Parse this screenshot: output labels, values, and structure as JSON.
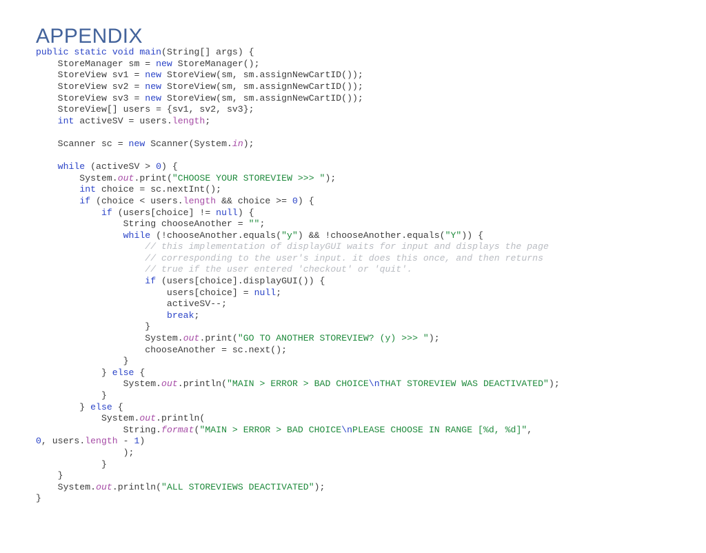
{
  "page": {
    "title": "APPENDIX",
    "background_color": "#ffffff",
    "title_color": "#43639b"
  },
  "code": {
    "language": "Java",
    "theme_colors": {
      "keyword": "#2b44c7",
      "string": "#1f8a3c",
      "escape": "#2b44c7",
      "number": "#2b44c7",
      "static_field": "#a64ca6",
      "member": "#a64ca6",
      "comment": "#b9bcc2",
      "plain": "#3c3c3c"
    },
    "plain_text": "public static void main(String[] args) {\n    StoreManager sm = new StoreManager();\n    StoreView sv1 = new StoreView(sm, sm.assignNewCartID());\n    StoreView sv2 = new StoreView(sm, sm.assignNewCartID());\n    StoreView sv3 = new StoreView(sm, sm.assignNewCartID());\n    StoreView[] users = {sv1, sv2, sv3};\n    int activeSV = users.length;\n\n    Scanner sc = new Scanner(System.in);\n\n    while (activeSV > 0) {\n        System.out.print(\"CHOOSE YOUR STOREVIEW >>> \");\n        int choice = sc.nextInt();\n        if (choice < users.length && choice >= 0) {\n            if (users[choice] != null) {\n                String chooseAnother = \"\";\n                while (!chooseAnother.equals(\"y\") && !chooseAnother.equals(\"Y\")) {\n                    // this implementation of displayGUI waits for input and displays the page\n                    // corresponding to the user's input. it does this once, and then returns\n                    // true if the user entered 'checkout' or 'quit'.\n                    if (users[choice].displayGUI()) {\n                        users[choice] = null;\n                        activeSV--;\n                        break;\n                    }\n                    System.out.print(\"GO TO ANOTHER STOREVIEW? (y) >>> \");\n                    chooseAnother = sc.next();\n                }\n            } else {\n                System.out.println(\"MAIN > ERROR > BAD CHOICE\\nTHAT STOREVIEW WAS DEACTIVATED\");\n            }\n        } else {\n            System.out.println(\n                String.format(\"MAIN > ERROR > BAD CHOICE\\nPLEASE CHOOSE IN RANGE [%d, %d]\",\n0, users.length - 1)\n            );\n        }\n    }\n    System.out.println(\"ALL STOREVIEWS DEACTIVATED\");\n}",
    "lines": [
      [
        {
          "t": "public",
          "c": "kw"
        },
        {
          "t": " ",
          "c": "pln"
        },
        {
          "t": "static",
          "c": "kw"
        },
        {
          "t": " ",
          "c": "pln"
        },
        {
          "t": "void",
          "c": "kw"
        },
        {
          "t": " ",
          "c": "pln"
        },
        {
          "t": "main",
          "c": "kw"
        },
        {
          "t": "(String[] args) {",
          "c": "pln"
        }
      ],
      [
        {
          "t": "    StoreManager sm = ",
          "c": "pln"
        },
        {
          "t": "new",
          "c": "kw"
        },
        {
          "t": " StoreManager();",
          "c": "pln"
        }
      ],
      [
        {
          "t": "    StoreView sv1 = ",
          "c": "pln"
        },
        {
          "t": "new",
          "c": "kw"
        },
        {
          "t": " StoreView(sm, sm.assignNewCartID());",
          "c": "pln"
        }
      ],
      [
        {
          "t": "    StoreView sv2 = ",
          "c": "pln"
        },
        {
          "t": "new",
          "c": "kw"
        },
        {
          "t": " StoreView(sm, sm.assignNewCartID());",
          "c": "pln"
        }
      ],
      [
        {
          "t": "    StoreView sv3 = ",
          "c": "pln"
        },
        {
          "t": "new",
          "c": "kw"
        },
        {
          "t": " StoreView(sm, sm.assignNewCartID());",
          "c": "pln"
        }
      ],
      [
        {
          "t": "    StoreView[] users = {sv1, sv2, sv3};",
          "c": "pln"
        }
      ],
      [
        {
          "t": "    ",
          "c": "pln"
        },
        {
          "t": "int",
          "c": "kw"
        },
        {
          "t": " activeSV = users.",
          "c": "pln"
        },
        {
          "t": "length",
          "c": "mem"
        },
        {
          "t": ";",
          "c": "pln"
        }
      ],
      [
        {
          "t": "",
          "c": "pln"
        }
      ],
      [
        {
          "t": "    Scanner sc = ",
          "c": "pln"
        },
        {
          "t": "new",
          "c": "kw"
        },
        {
          "t": " Scanner(System.",
          "c": "pln"
        },
        {
          "t": "in",
          "c": "fld"
        },
        {
          "t": ");",
          "c": "pln"
        }
      ],
      [
        {
          "t": "",
          "c": "pln"
        }
      ],
      [
        {
          "t": "    ",
          "c": "pln"
        },
        {
          "t": "while",
          "c": "kw"
        },
        {
          "t": " (activeSV > ",
          "c": "pln"
        },
        {
          "t": "0",
          "c": "num"
        },
        {
          "t": ") {",
          "c": "pln"
        }
      ],
      [
        {
          "t": "        System.",
          "c": "pln"
        },
        {
          "t": "out",
          "c": "fld"
        },
        {
          "t": ".print(",
          "c": "pln"
        },
        {
          "t": "\"CHOOSE YOUR STOREVIEW >>> \"",
          "c": "str"
        },
        {
          "t": ");",
          "c": "pln"
        }
      ],
      [
        {
          "t": "        ",
          "c": "pln"
        },
        {
          "t": "int",
          "c": "kw"
        },
        {
          "t": " choice = sc.nextInt();",
          "c": "pln"
        }
      ],
      [
        {
          "t": "        ",
          "c": "pln"
        },
        {
          "t": "if",
          "c": "kw"
        },
        {
          "t": " (choice < users.",
          "c": "pln"
        },
        {
          "t": "length",
          "c": "mem"
        },
        {
          "t": " && choice >= ",
          "c": "pln"
        },
        {
          "t": "0",
          "c": "num"
        },
        {
          "t": ") {",
          "c": "pln"
        }
      ],
      [
        {
          "t": "            ",
          "c": "pln"
        },
        {
          "t": "if",
          "c": "kw"
        },
        {
          "t": " (users[choice] != ",
          "c": "pln"
        },
        {
          "t": "null",
          "c": "kw"
        },
        {
          "t": ") {",
          "c": "pln"
        }
      ],
      [
        {
          "t": "                String chooseAnother = ",
          "c": "pln"
        },
        {
          "t": "\"\"",
          "c": "str"
        },
        {
          "t": ";",
          "c": "pln"
        }
      ],
      [
        {
          "t": "                ",
          "c": "pln"
        },
        {
          "t": "while",
          "c": "kw"
        },
        {
          "t": " (!chooseAnother.equals(",
          "c": "pln"
        },
        {
          "t": "\"y\"",
          "c": "str"
        },
        {
          "t": ") && !chooseAnother.equals(",
          "c": "pln"
        },
        {
          "t": "\"Y\"",
          "c": "str"
        },
        {
          "t": ")) {",
          "c": "pln"
        }
      ],
      [
        {
          "t": "                    // this implementation of displayGUI waits for input and displays the page",
          "c": "cmt"
        }
      ],
      [
        {
          "t": "                    // corresponding to the user's input. it does this once, and then returns",
          "c": "cmt"
        }
      ],
      [
        {
          "t": "                    // true if the user entered 'checkout' or 'quit'.",
          "c": "cmt"
        }
      ],
      [
        {
          "t": "                    ",
          "c": "pln"
        },
        {
          "t": "if",
          "c": "kw"
        },
        {
          "t": " (users[choice].displayGUI()) {",
          "c": "pln"
        }
      ],
      [
        {
          "t": "                        users[choice] = ",
          "c": "pln"
        },
        {
          "t": "null",
          "c": "kw"
        },
        {
          "t": ";",
          "c": "pln"
        }
      ],
      [
        {
          "t": "                        activeSV--;",
          "c": "pln"
        }
      ],
      [
        {
          "t": "                        ",
          "c": "pln"
        },
        {
          "t": "break",
          "c": "kw"
        },
        {
          "t": ";",
          "c": "pln"
        }
      ],
      [
        {
          "t": "                    }",
          "c": "pln"
        }
      ],
      [
        {
          "t": "                    System.",
          "c": "pln"
        },
        {
          "t": "out",
          "c": "fld"
        },
        {
          "t": ".print(",
          "c": "pln"
        },
        {
          "t": "\"GO TO ANOTHER STOREVIEW? (y) >>> \"",
          "c": "str"
        },
        {
          "t": ");",
          "c": "pln"
        }
      ],
      [
        {
          "t": "                    chooseAnother = sc.next();",
          "c": "pln"
        }
      ],
      [
        {
          "t": "                }",
          "c": "pln"
        }
      ],
      [
        {
          "t": "            } ",
          "c": "pln"
        },
        {
          "t": "else",
          "c": "kw"
        },
        {
          "t": " {",
          "c": "pln"
        }
      ],
      [
        {
          "t": "                System.",
          "c": "pln"
        },
        {
          "t": "out",
          "c": "fld"
        },
        {
          "t": ".println(",
          "c": "pln"
        },
        {
          "t": "\"MAIN > ERROR > BAD CHOICE",
          "c": "str"
        },
        {
          "t": "\\n",
          "c": "esc"
        },
        {
          "t": "THAT STOREVIEW WAS DEACTIVATED\"",
          "c": "str"
        },
        {
          "t": ");",
          "c": "pln"
        }
      ],
      [
        {
          "t": "            }",
          "c": "pln"
        }
      ],
      [
        {
          "t": "        } ",
          "c": "pln"
        },
        {
          "t": "else",
          "c": "kw"
        },
        {
          "t": " {",
          "c": "pln"
        }
      ],
      [
        {
          "t": "            System.",
          "c": "pln"
        },
        {
          "t": "out",
          "c": "fld"
        },
        {
          "t": ".println(",
          "c": "pln"
        }
      ],
      [
        {
          "t": "                String.",
          "c": "pln"
        },
        {
          "t": "format",
          "c": "fld"
        },
        {
          "t": "(",
          "c": "pln"
        },
        {
          "t": "\"MAIN > ERROR > BAD CHOICE",
          "c": "str"
        },
        {
          "t": "\\n",
          "c": "esc"
        },
        {
          "t": "PLEASE CHOOSE IN RANGE [%d, %d]\"",
          "c": "str"
        },
        {
          "t": ",",
          "c": "pln"
        }
      ],
      [
        {
          "t": "0",
          "c": "num"
        },
        {
          "t": ", users.",
          "c": "pln"
        },
        {
          "t": "length",
          "c": "mem"
        },
        {
          "t": " - ",
          "c": "pln"
        },
        {
          "t": "1",
          "c": "num"
        },
        {
          "t": ")",
          "c": "pln"
        }
      ],
      [
        {
          "t": "                );",
          "c": "pln"
        }
      ],
      [
        {
          "t": "            }",
          "c": "pln"
        }
      ],
      [
        {
          "t": "    }",
          "c": "pln"
        }
      ],
      [
        {
          "t": "    System.",
          "c": "pln"
        },
        {
          "t": "out",
          "c": "fld"
        },
        {
          "t": ".println(",
          "c": "pln"
        },
        {
          "t": "\"ALL STOREVIEWS DEACTIVATED\"",
          "c": "str"
        },
        {
          "t": ");",
          "c": "pln"
        }
      ],
      [
        {
          "t": "}",
          "c": "pln"
        }
      ]
    ]
  }
}
